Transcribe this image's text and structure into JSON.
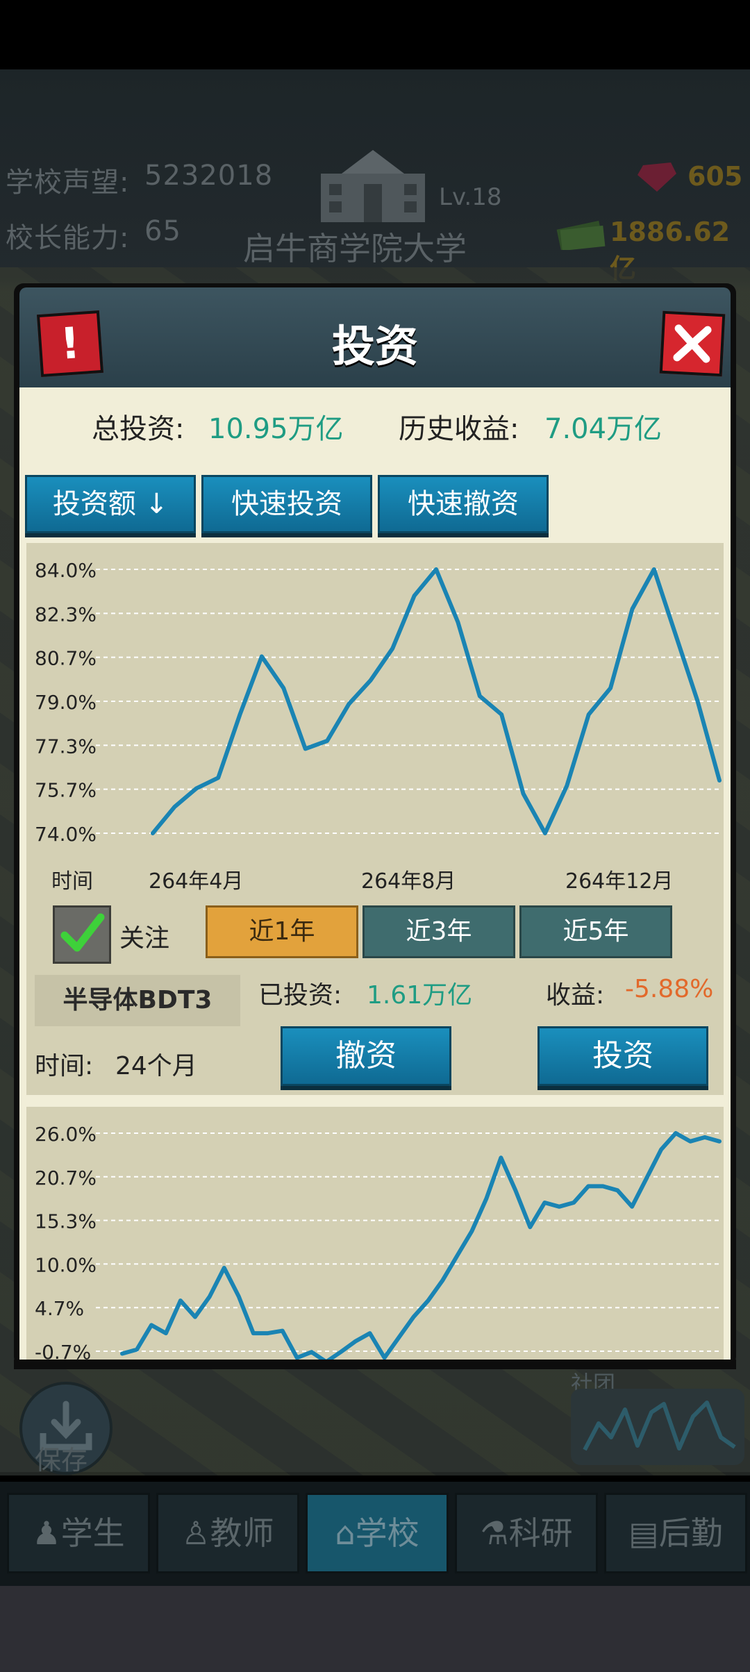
{
  "hud": {
    "reputation_label": "学校声望:",
    "reputation_value": "5232018",
    "ability_label": "校长能力:",
    "ability_value": "65",
    "school_name": "启牛商学院大学",
    "level": "Lv.18",
    "gems": "605",
    "money": "1886.62亿"
  },
  "dialog": {
    "title": "投资",
    "warn_glyph": "!",
    "total_invest_label": "总投资:",
    "total_invest_value": "10.95万亿",
    "history_return_label": "历史收益:",
    "history_return_value": "7.04万亿",
    "buttons": {
      "sort": "投资额 ↓",
      "quick_invest": "快速投资",
      "quick_withdraw": "快速撤资"
    }
  },
  "stock": {
    "x_axis_label": "时间",
    "follow_label": "关注",
    "ranges": [
      "近1年",
      "近3年",
      "近5年"
    ],
    "name": "半导体BDT3",
    "invested_label": "已投资:",
    "invested_value": "1.61万亿",
    "return_label": "收益:",
    "return_value": "-5.88%",
    "time_label": "时间:",
    "time_value": "24个月",
    "withdraw_label": "撤资",
    "invest_label": "投资"
  },
  "chart_data": [
    {
      "type": "line",
      "yticks": [
        "84.0%",
        "82.3%",
        "80.7%",
        "79.0%",
        "77.3%",
        "75.7%",
        "74.0%"
      ],
      "xticks": [
        "264年4月",
        "264年8月",
        "264年12月"
      ],
      "ylim": [
        74.0,
        84.0
      ],
      "grid": true,
      "x": [
        0,
        0.5,
        1,
        1.5,
        2,
        2.5,
        3,
        3.5,
        4,
        4.5,
        5,
        5.5,
        6,
        6.5,
        7,
        7.5,
        8,
        8.5,
        9,
        9.5,
        10,
        10.5,
        11,
        11.5,
        12,
        12.5,
        13
      ],
      "values": [
        74.0,
        75.0,
        75.7,
        76.1,
        78.5,
        80.7,
        79.5,
        77.2,
        77.5,
        78.9,
        79.8,
        81.0,
        83.0,
        84.0,
        82.0,
        79.2,
        78.5,
        75.5,
        74.0,
        75.8,
        78.5,
        79.5,
        82.5,
        84.0,
        81.5,
        79.0,
        76.0
      ]
    },
    {
      "type": "line",
      "yticks": [
        "26.0%",
        "20.7%",
        "15.3%",
        "10.0%",
        "4.7%",
        "-0.7%"
      ],
      "ylim": [
        -0.7,
        26.0
      ],
      "grid": true,
      "x": [
        0,
        1,
        2,
        3,
        4,
        5,
        6,
        7,
        8,
        9,
        10,
        11,
        12,
        13,
        14,
        15,
        16,
        17,
        18,
        19,
        20,
        21,
        22,
        23,
        24,
        25,
        26,
        27,
        28,
        29,
        30,
        31,
        32,
        33,
        34,
        35,
        36,
        37,
        38,
        39,
        40,
        41
      ],
      "values": [
        -1.0,
        -0.5,
        2.5,
        1.5,
        5.5,
        3.5,
        6.0,
        9.5,
        6.0,
        1.5,
        1.5,
        1.8,
        -1.5,
        -0.8,
        -2.0,
        -0.8,
        0.5,
        1.5,
        -1.5,
        1.0,
        3.5,
        5.5,
        8.0,
        11.0,
        14.0,
        18.0,
        23.0,
        19.0,
        14.5,
        17.5,
        17.0,
        17.5,
        19.5,
        19.5,
        19.0,
        17.0,
        20.5,
        24.0,
        26.0,
        25.0,
        25.5,
        25.0
      ]
    }
  ],
  "bottom": {
    "save_label": "保存",
    "club_label": "社团"
  },
  "nav": [
    "学生",
    "教师",
    "学校",
    "科研",
    "后勤"
  ],
  "colors": {
    "line": "#1a84b3",
    "green_value": "#1f9c83",
    "negative_value": "#e2692b",
    "button_blue": "#1281ad",
    "range_active": "#e2a23c"
  }
}
